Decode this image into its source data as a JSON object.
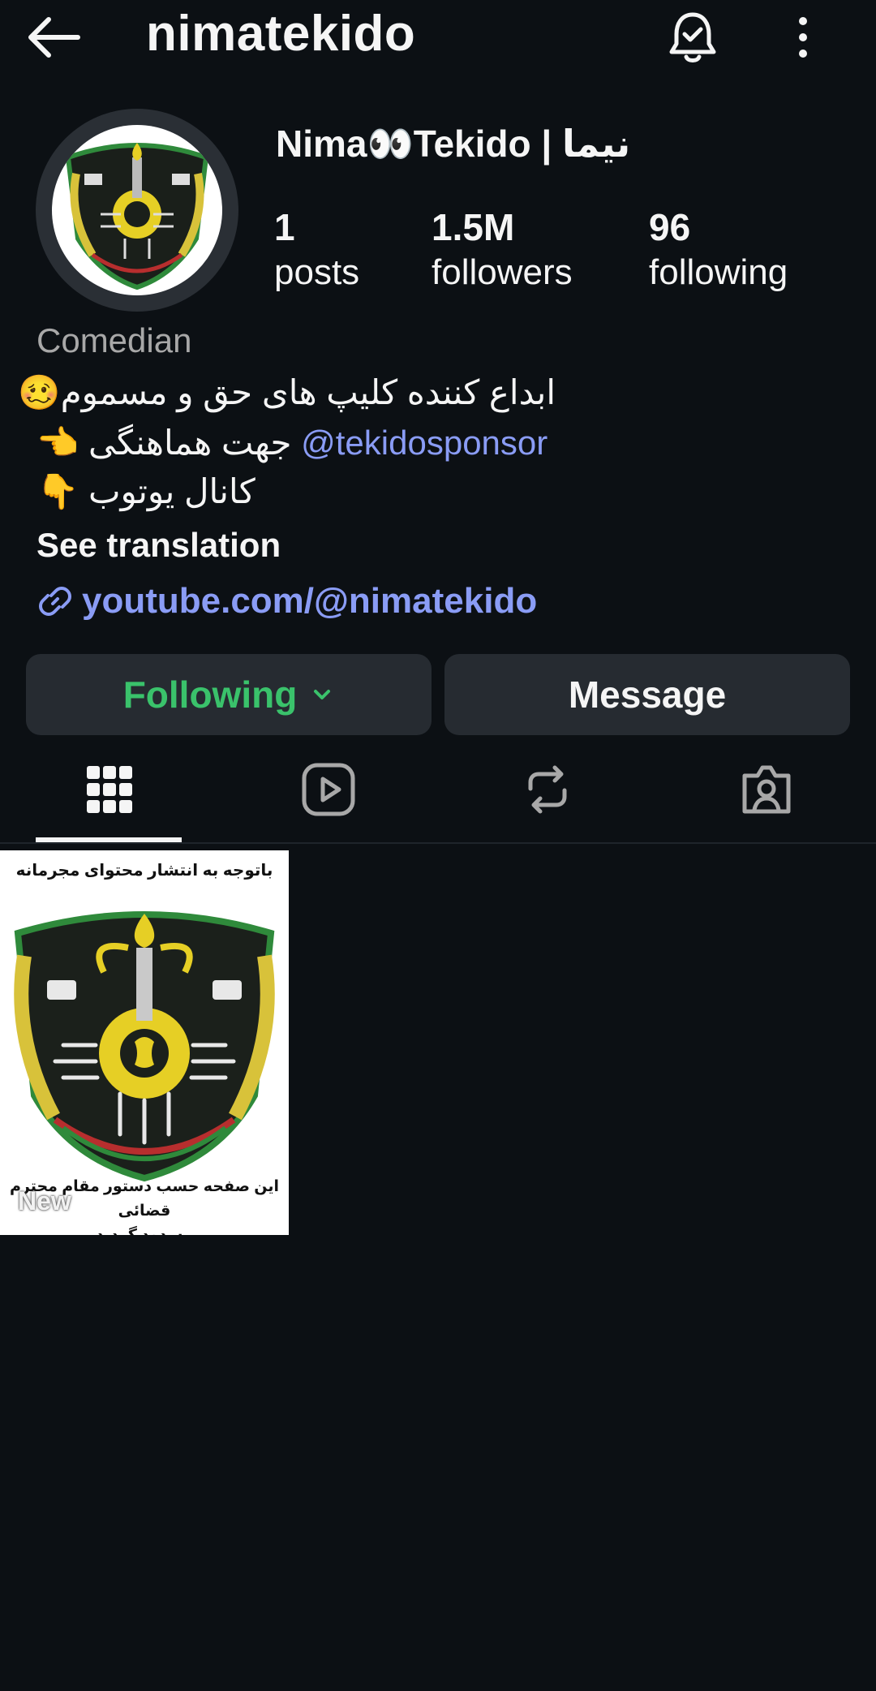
{
  "header": {
    "username": "nimatekido"
  },
  "profile": {
    "display_name": "Nima👀Tekido | نیما",
    "stats": {
      "posts": {
        "value": "1",
        "label": "posts"
      },
      "followers": {
        "value": "1.5M",
        "label": "followers"
      },
      "following": {
        "value": "96",
        "label": "following"
      }
    },
    "category": "Comedian",
    "bio": {
      "line1": "ابداع کننده کلیپ های حق و مسموم🥴",
      "line2_text": " جهت هماهنگی 👈",
      "line2_mention": "@tekidosponsor",
      "line3": "کانال یوتوب 👇"
    },
    "see_translation": "See translation",
    "link": "youtube.com/@nimatekido"
  },
  "actions": {
    "following_label": "Following",
    "message_label": "Message"
  },
  "tabs": [
    "posts-grid-icon",
    "reels-icon",
    "reposts-icon",
    "tagged-icon"
  ],
  "posts": [
    {
      "top_text": "باتوجه به انتشار محتوای مجرمانه",
      "bottom_text_line1": "این صفحه حسب دستور مقام محترم قضائی",
      "bottom_text_line2": "مسدود گردید",
      "badge": "New"
    }
  ],
  "colors": {
    "background": "#0c1014",
    "button": "#262b31",
    "following": "#3ac26b",
    "link": "#8a9cf5"
  }
}
